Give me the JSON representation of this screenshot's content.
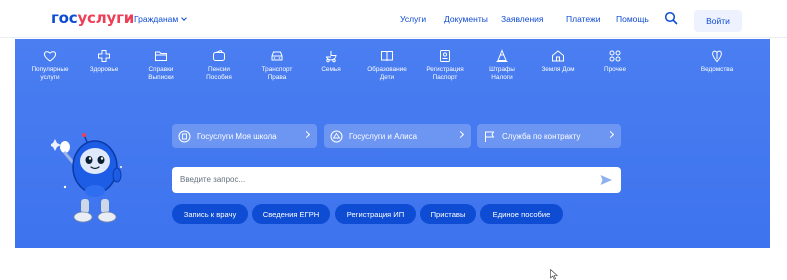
{
  "header": {
    "logo_part1": "гос",
    "logo_part2": "услуги",
    "audience": "Гражданам",
    "nav": [
      "Услуги",
      "Документы",
      "Заявления",
      "Платежи",
      "Помощь"
    ],
    "login": "Войти"
  },
  "categories": [
    {
      "l1": "Популярные",
      "l2": "услуги",
      "icon": "heart-icon"
    },
    {
      "l1": "Здоровье",
      "l2": "",
      "icon": "medical-cross-icon"
    },
    {
      "l1": "Справки",
      "l2": "Выписки",
      "icon": "folder-icon"
    },
    {
      "l1": "Пенсии",
      "l2": "Пособия",
      "icon": "wallet-icon"
    },
    {
      "l1": "Транспорт",
      "l2": "Права",
      "icon": "car-icon"
    },
    {
      "l1": "Семья",
      "l2": "",
      "icon": "stroller-icon"
    },
    {
      "l1": "Образование",
      "l2": "Дети",
      "icon": "book-icon"
    },
    {
      "l1": "Регистрация",
      "l2": "Паспорт",
      "icon": "passport-icon"
    },
    {
      "l1": "Штрафы",
      "l2": "Налоги",
      "icon": "traffic-cone-icon"
    },
    {
      "l1": "Земля Дом",
      "l2": "",
      "icon": "house-icon"
    },
    {
      "l1": "Прочее",
      "l2": "",
      "icon": "grid-icon"
    },
    {
      "l1": "Ведомства",
      "l2": "",
      "icon": "emblem-icon"
    }
  ],
  "promo": {
    "school": "Госуслуги Моя школа",
    "alice": "Госуслуги и Алиса",
    "contract": "Служба по контракту"
  },
  "search": {
    "placeholder": "Введите запрос..."
  },
  "quick_links": [
    "Запись к врачу",
    "Сведения ЕГРН",
    "Регистрация ИП",
    "Приставы",
    "Единое пособие"
  ],
  "colors": {
    "brand_blue": "#0d4cd3",
    "brand_red": "#ee3f58",
    "hero_blue": "#3e74f0"
  }
}
